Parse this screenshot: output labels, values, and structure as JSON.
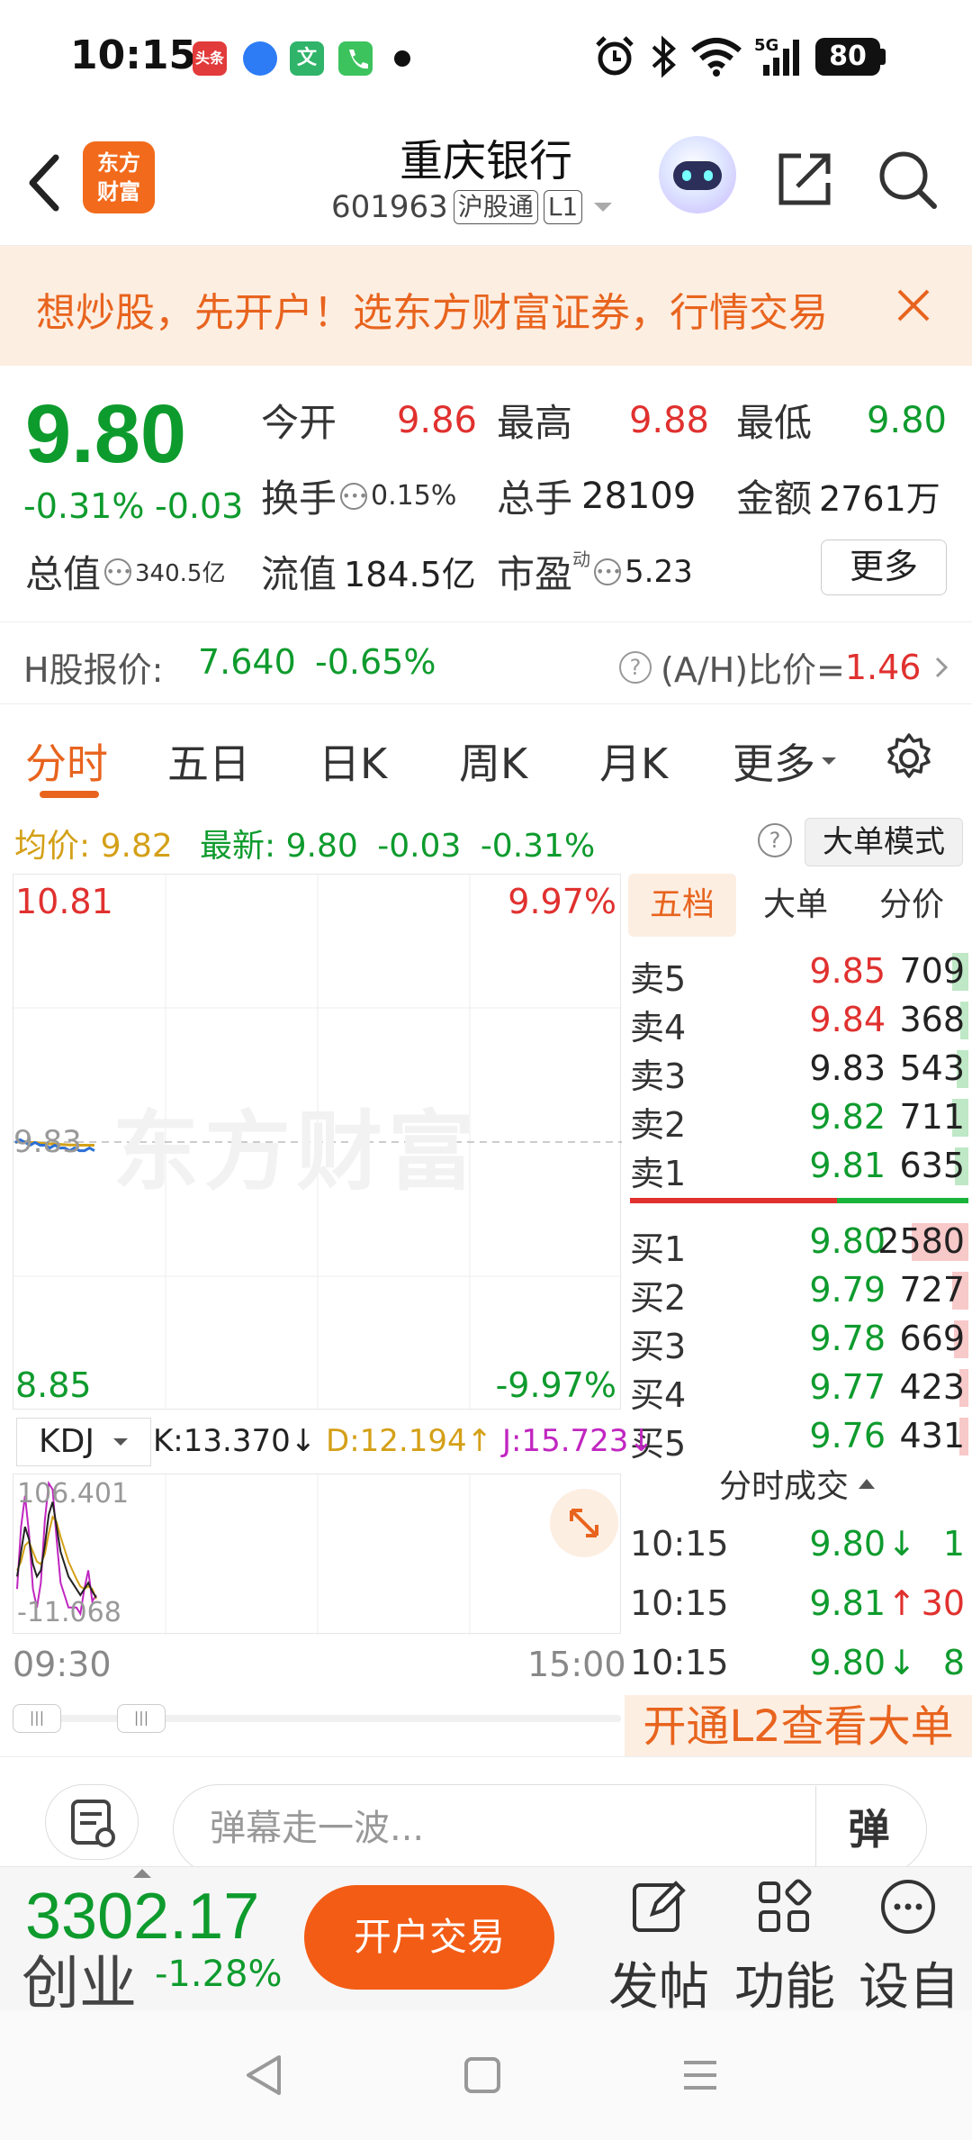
{
  "status": {
    "time": "10:15",
    "battery": "80",
    "app_icons": [
      {
        "name": "toutiao-icon",
        "label": "头条",
        "color": "#e23b3b"
      },
      {
        "name": "browser-icon",
        "label": "",
        "color": "#2d7cf6"
      },
      {
        "name": "translate-icon",
        "label": "文",
        "color": "#2fb46a"
      },
      {
        "name": "phone-icon",
        "label": "",
        "color": "#3cc35e"
      }
    ]
  },
  "header": {
    "stock_name": "重庆银行",
    "stock_code": "601963",
    "tag_market": "沪股通",
    "tag_level": "L1",
    "logo_line1": "东方",
    "logo_line2": "财富"
  },
  "banner": {
    "text": "想炒股，先开户！选东方财富证券，行情交易"
  },
  "quote": {
    "price": "9.80",
    "pct": "-0.31%",
    "chg": "-0.03",
    "open_label": "今开",
    "open": "9.86",
    "high_label": "最高",
    "high": "9.88",
    "low_label": "最低",
    "low": "9.80",
    "turnover_label": "换手",
    "turnover": "0.15%",
    "volume_label": "总手",
    "volume": "28109",
    "amount_label": "金额",
    "amount": "2761万",
    "mcap_label": "总值",
    "mcap": "340.5亿",
    "float_label": "流值",
    "float": "184.5亿",
    "pe_label": "市盈",
    "pe_sup": "动",
    "pe": "5.23",
    "more": "更多"
  },
  "hshare": {
    "label": "H股报价:",
    "price": "7.640",
    "pct": "-0.65%",
    "ah_label": "(A/H)比价=",
    "ah_value": "1.46"
  },
  "tabs": [
    "分时",
    "五日",
    "日K",
    "周K",
    "月K",
    "更多"
  ],
  "avgrow": {
    "avg_label": "均价:",
    "avg_value": "9.82",
    "latest_label": "最新:",
    "latest_value": "9.80",
    "latest_chg": "-0.03",
    "latest_pct": "-0.31%",
    "mode_button": "大单模式"
  },
  "chart": {
    "y_top": "10.81",
    "y_bottom": "8.85",
    "y_mid": "9.83",
    "pct_top": "9.97%",
    "pct_bottom": "-9.97%",
    "watermark": "东方财富",
    "x_start": "09:30",
    "x_end": "15:00",
    "price_series": [
      9.83,
      9.84,
      9.83,
      9.82,
      9.83,
      9.82,
      9.82,
      9.81,
      9.82,
      9.81,
      9.81,
      9.8,
      9.81,
      9.8,
      9.8,
      9.81,
      9.8
    ],
    "avg_series": [
      9.83,
      9.835,
      9.833,
      9.83,
      9.83,
      9.828,
      9.826,
      9.825,
      9.824,
      9.823,
      9.822,
      9.821,
      9.821,
      9.82,
      9.82,
      9.82,
      9.82
    ]
  },
  "kdj": {
    "select_label": "KDJ",
    "k_label": "K:13.370",
    "d_label": "D:12.194",
    "j_label": "J:15.723",
    "y_top": "106.401",
    "y_bottom": "-11.068",
    "k_series": [
      30,
      50,
      70,
      60,
      40,
      30,
      35,
      55,
      80,
      90,
      70,
      50,
      40,
      30,
      25,
      20,
      15,
      20,
      25,
      18,
      13
    ],
    "d_series": [
      35,
      42,
      55,
      58,
      50,
      42,
      40,
      48,
      65,
      78,
      74,
      62,
      52,
      42,
      35,
      28,
      22,
      20,
      22,
      20,
      12
    ],
    "j_series": [
      20,
      70,
      95,
      65,
      20,
      5,
      25,
      75,
      105,
      100,
      60,
      25,
      15,
      5,
      5,
      5,
      0,
      20,
      35,
      10,
      15
    ]
  },
  "book": {
    "tabs": [
      "五档",
      "大单",
      "分价"
    ],
    "sell": [
      {
        "label": "卖5",
        "price": "9.85",
        "vol": "709",
        "bar": 0.12
      },
      {
        "label": "卖4",
        "price": "9.84",
        "vol": "368",
        "bar": 0.06
      },
      {
        "label": "卖3",
        "price": "9.83",
        "vol": "543",
        "bar": 0.09
      },
      {
        "label": "卖2",
        "price": "9.82",
        "vol": "711",
        "bar": 0.12
      },
      {
        "label": "卖1",
        "price": "9.81",
        "vol": "635",
        "bar": 0.1
      }
    ],
    "buy": [
      {
        "label": "买1",
        "price": "9.80",
        "vol": "2580",
        "bar": 0.42
      },
      {
        "label": "买2",
        "price": "9.79",
        "vol": "727",
        "bar": 0.12
      },
      {
        "label": "买3",
        "price": "9.78",
        "vol": "669",
        "bar": 0.11
      },
      {
        "label": "买4",
        "price": "9.77",
        "vol": "423",
        "bar": 0.07
      },
      {
        "label": "买5",
        "price": "9.76",
        "vol": "431",
        "bar": 0.07
      }
    ],
    "ticks_title": "分时成交",
    "ticks": [
      {
        "time": "10:15",
        "price": "9.80",
        "dir": "down",
        "vol": "1"
      },
      {
        "time": "10:15",
        "price": "9.81",
        "dir": "up",
        "vol": "30"
      },
      {
        "time": "10:15",
        "price": "9.80",
        "dir": "down",
        "vol": "8"
      }
    ],
    "l2_banner": "开通L2查看大单"
  },
  "danmaku": {
    "placeholder": "弹幕走一波...",
    "send": "弹"
  },
  "bottombar": {
    "index_value": "3302.17",
    "index_name": "创业",
    "index_pct": "-1.28%",
    "trade_button": "开户交易",
    "post": "发帖",
    "func": "功能",
    "custom": "设自"
  },
  "colors": {
    "up": "#e0312f",
    "down": "#0e9b2d",
    "accent": "#e8641e",
    "avg": "#d4a017"
  }
}
